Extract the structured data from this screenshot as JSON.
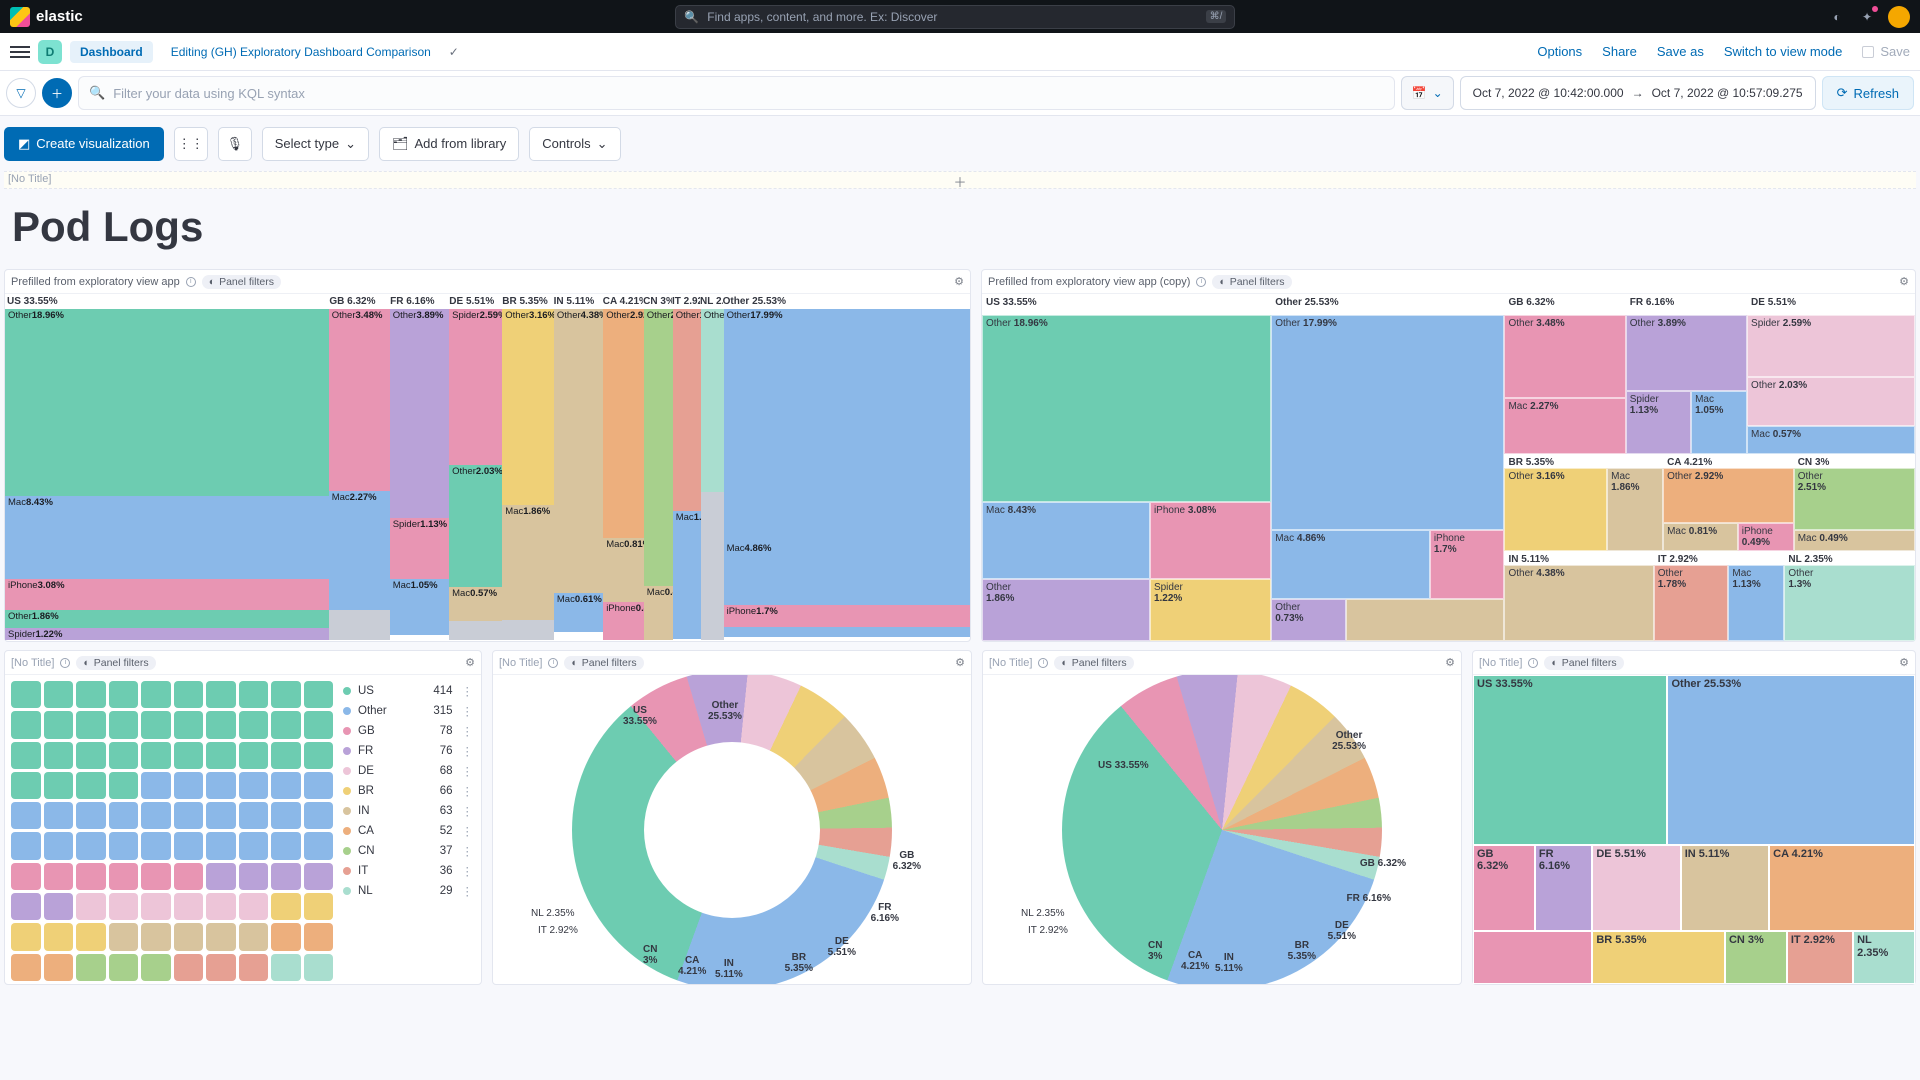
{
  "header": {
    "brand": "elastic",
    "search_placeholder": "Find apps, content, and more. Ex: Discover",
    "kbd": "⌘/"
  },
  "crumbs": {
    "space_letter": "D",
    "dashboard": "Dashboard",
    "editing": "Editing (GH) Exploratory Dashboard Comparison",
    "options": "Options",
    "share": "Share",
    "save_as": "Save as",
    "switch": "Switch to view mode",
    "save": "Save"
  },
  "filter": {
    "placeholder": "Filter your data using KQL syntax",
    "from": "Oct 7, 2022 @ 10:42:00.000",
    "to": "Oct 7, 2022 @ 10:57:09.275",
    "refresh": "Refresh"
  },
  "toolbar": {
    "create": "Create visualization",
    "select_type": "Select type",
    "add_lib": "Add from library",
    "controls": "Controls"
  },
  "strip": {
    "no_title": "[No Title]"
  },
  "page_title": "Pod Logs",
  "panels": {
    "p1": "Prefilled from exploratory view app",
    "p2": "Prefilled from exploratory view app (copy)",
    "no_title": "[No Title]",
    "filters": "Panel filters"
  },
  "chart_data": {
    "countries": [
      {
        "code": "US",
        "pct": 33.55,
        "breakdown": [
          {
            "name": "Other",
            "pct": 18.96
          },
          {
            "name": "Mac",
            "pct": 8.43
          },
          {
            "name": "iPhone",
            "pct": 3.08
          },
          {
            "name": "Other",
            "pct": 1.86
          },
          {
            "name": "Spider",
            "pct": 1.22
          }
        ]
      },
      {
        "code": "GB",
        "pct": 6.32,
        "breakdown": [
          {
            "name": "Other",
            "pct": 3.48
          },
          {
            "name": "Mac",
            "pct": 2.27
          }
        ]
      },
      {
        "code": "FR",
        "pct": 6.16,
        "breakdown": [
          {
            "name": "Other",
            "pct": 3.89
          },
          {
            "name": "Spider",
            "pct": 1.13
          },
          {
            "name": "Mac",
            "pct": 1.05
          }
        ]
      },
      {
        "code": "DE",
        "pct": 5.51,
        "breakdown": [
          {
            "name": "Spider",
            "pct": 2.59
          },
          {
            "name": "Other",
            "pct": 2.03
          },
          {
            "name": "Mac",
            "pct": 0.57
          }
        ]
      },
      {
        "code": "BR",
        "pct": 5.35,
        "breakdown": [
          {
            "name": "Other",
            "pct": 3.16
          },
          {
            "name": "Mac",
            "pct": 1.86
          }
        ]
      },
      {
        "code": "IN",
        "pct": 5.11,
        "breakdown": [
          {
            "name": "Other",
            "pct": 4.38
          },
          {
            "name": "Mac",
            "pct": 0.61
          }
        ]
      },
      {
        "code": "CA",
        "pct": 4.21,
        "breakdown": [
          {
            "name": "Other",
            "pct": 2.92
          },
          {
            "name": "Mac",
            "pct": 0.81
          },
          {
            "name": "iPhone",
            "pct": 0.49
          }
        ]
      },
      {
        "code": "CN",
        "pct": 3.0,
        "breakdown": [
          {
            "name": "Other",
            "pct": 2.51
          },
          {
            "name": "Mac",
            "pct": 0.49
          }
        ]
      },
      {
        "code": "IT",
        "pct": 2.92,
        "breakdown": [
          {
            "name": "Other",
            "pct": 1.78
          },
          {
            "name": "Mac",
            "pct": 1.13
          }
        ]
      },
      {
        "code": "NL",
        "pct": 2.35,
        "breakdown": [
          {
            "name": "Other",
            "pct": 1.3
          }
        ]
      },
      {
        "code": "Other",
        "pct": 25.53,
        "breakdown": [
          {
            "name": "Other",
            "pct": 17.99
          },
          {
            "name": "Mac",
            "pct": 4.86
          },
          {
            "name": "iPhone",
            "pct": 1.7
          },
          {
            "name": "Other",
            "pct": 0.73
          }
        ]
      }
    ],
    "waffle_legend": [
      {
        "code": "US",
        "v": 414,
        "color": "#6dccb1"
      },
      {
        "code": "Other",
        "v": 315,
        "color": "#8bb8e8"
      },
      {
        "code": "GB",
        "v": 78,
        "color": "#e895b3"
      },
      {
        "code": "FR",
        "v": 76,
        "color": "#b9a2d8"
      },
      {
        "code": "DE",
        "v": 68,
        "color": "#edc5d8"
      },
      {
        "code": "BR",
        "v": 66,
        "color": "#efd077"
      },
      {
        "code": "IN",
        "v": 63,
        "color": "#d8c49e"
      },
      {
        "code": "CA",
        "v": 52,
        "color": "#edaf7d"
      },
      {
        "code": "CN",
        "v": 37,
        "color": "#a7d08c"
      },
      {
        "code": "IT",
        "v": 36,
        "color": "#e6a093"
      },
      {
        "code": "NL",
        "v": 29,
        "color": "#a9decf"
      }
    ],
    "pie_outer_labels": {
      "nl": "NL 2.35%",
      "it": "IT 2.92%"
    }
  }
}
